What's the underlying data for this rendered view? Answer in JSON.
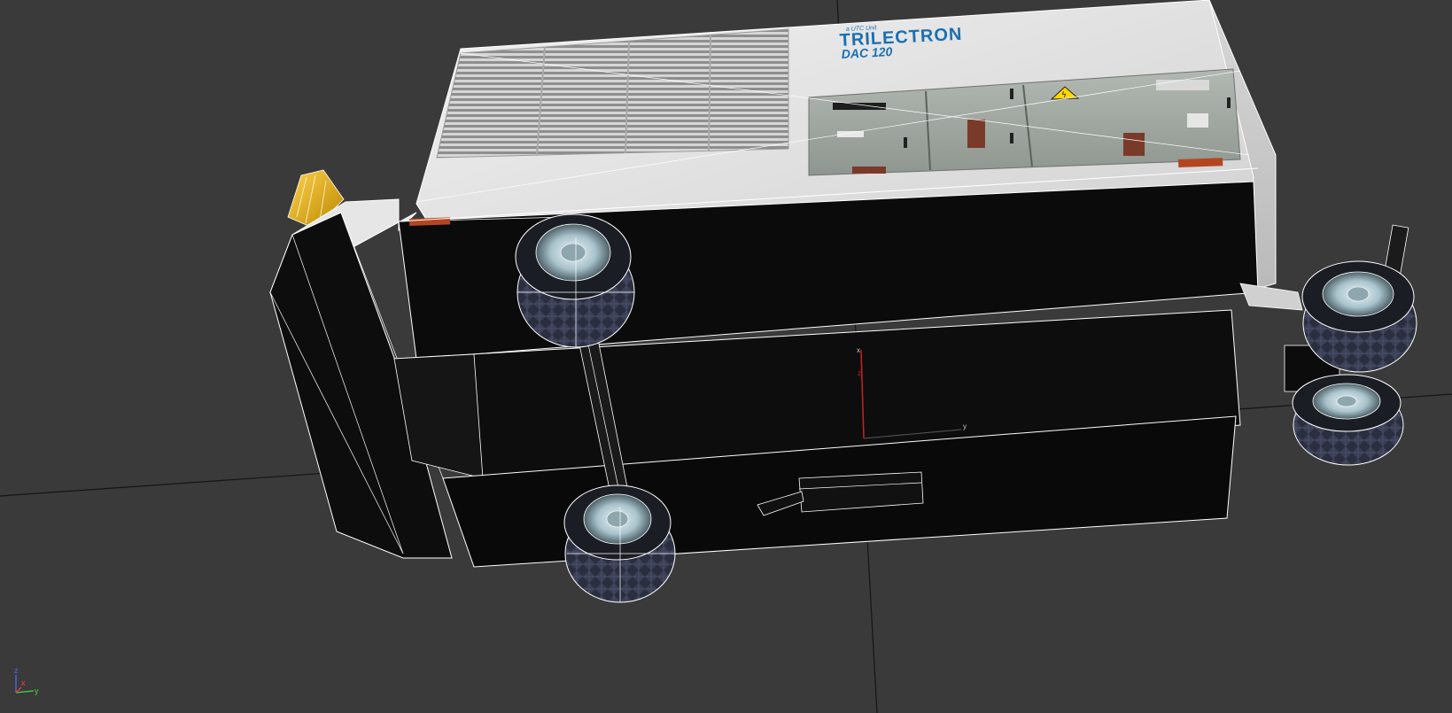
{
  "viewport": {
    "name": "3D perspective viewport",
    "background": "#3a3a3a",
    "wireframe_color": "#ffffff"
  },
  "model": {
    "brand_small": "a UTC Unit",
    "brand_name": "TRILECTRON",
    "model_name": "DAC 120",
    "brand_color": "#1a6fb3",
    "hazard_symbol": "ϟ",
    "tread_colors": [
      "#2b2e3f",
      "#3b3f55"
    ]
  },
  "transform_gizmo": {
    "x_label": "x",
    "y_label": "y",
    "z_label": "z"
  },
  "view_axis": {
    "x_label": "x",
    "y_label": "y",
    "z_label": "z",
    "x_color": "#ff3b3b",
    "y_color": "#3bdb3b",
    "z_color": "#4a6cff"
  }
}
